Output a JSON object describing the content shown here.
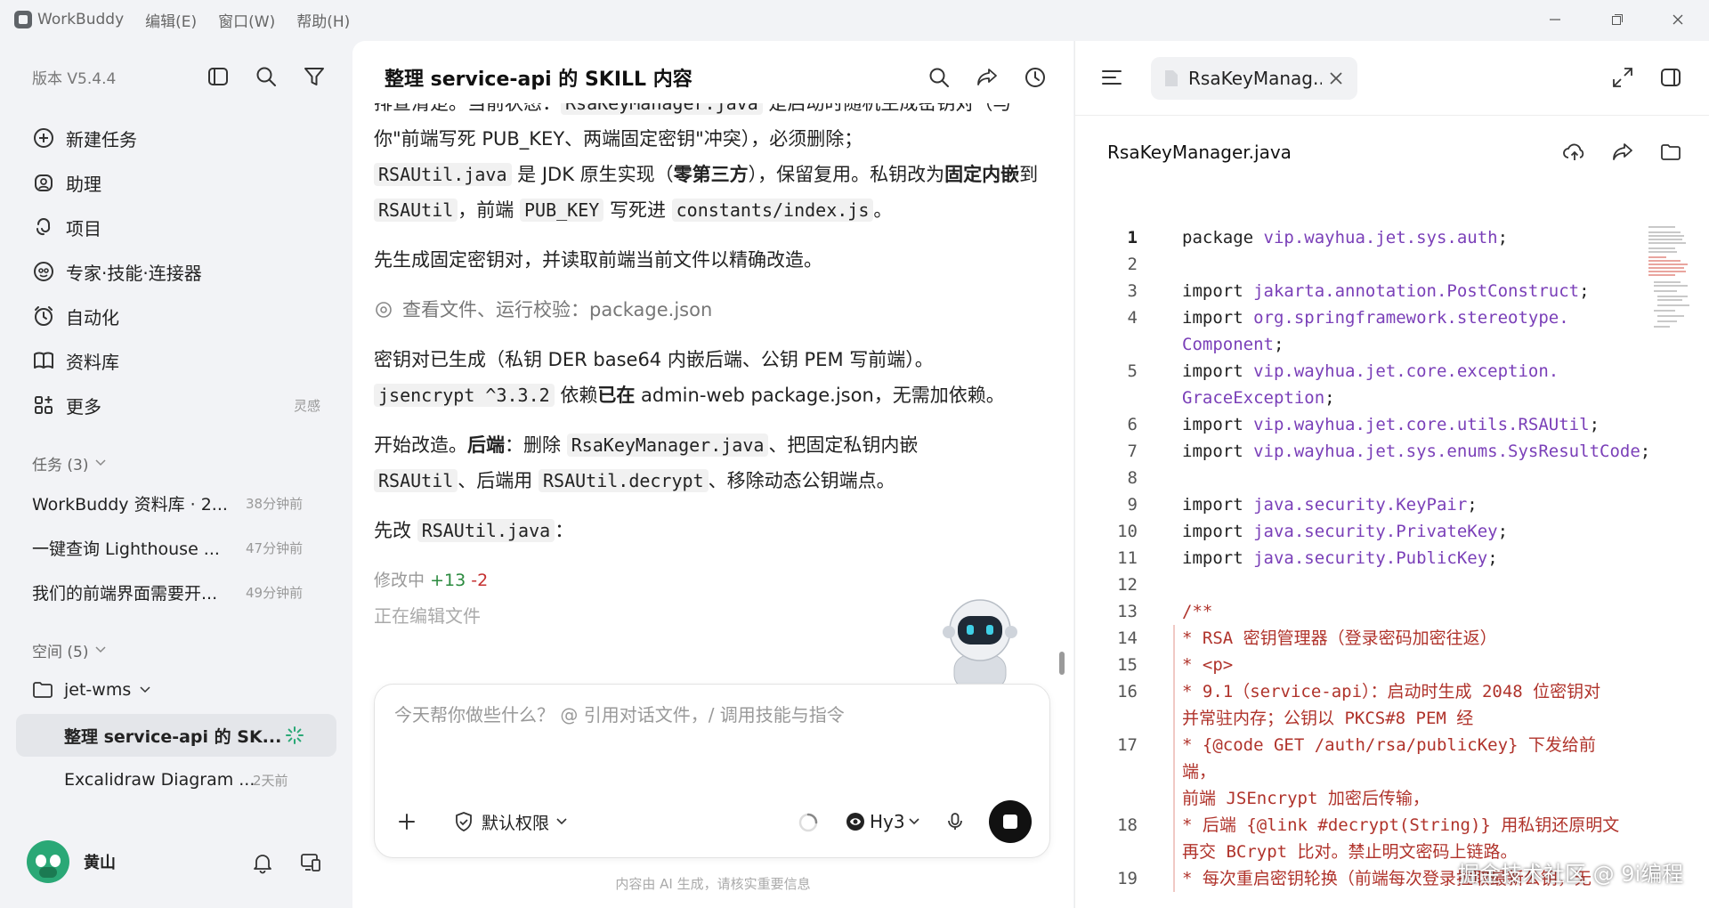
{
  "titlebar": {
    "app_name": "WorkBuddy",
    "menu": [
      "编辑(E)",
      "窗口(W)",
      "帮助(H)"
    ]
  },
  "sidebar": {
    "version": "版本 V5.4.4",
    "nav": [
      {
        "label": "新建任务",
        "icon": "plus-circle-icon"
      },
      {
        "label": "助理",
        "icon": "assistant-icon"
      },
      {
        "label": "项目",
        "icon": "project-icon"
      },
      {
        "label": "专家·技能·连接器",
        "icon": "expert-icon"
      },
      {
        "label": "自动化",
        "icon": "alarm-clock-icon"
      },
      {
        "label": "资料库",
        "icon": "book-icon"
      },
      {
        "label": "更多",
        "icon": "grid-icon",
        "badge": "灵感"
      }
    ],
    "tasks_header": "任务 (3)",
    "tasks": [
      {
        "title": "WorkBuddy 资料库 · 2...",
        "ago": "38分钟前"
      },
      {
        "title": "一键查询 Lighthouse ...",
        "ago": "47分钟前"
      },
      {
        "title": "我们的前端界面需要开...",
        "ago": "49分钟前"
      }
    ],
    "spaces_header": "空间 (5)",
    "project": "jet-wms",
    "project_items": [
      {
        "title": "整理 service-api 的 SK...",
        "active": true
      },
      {
        "title": "Excalidraw Diagram ...",
        "ago": "2天前"
      }
    ],
    "user_name": "黄山"
  },
  "chat": {
    "title": "整理 service-api 的 SKILL 内容",
    "line0_a": "排查清楚。当前状态：",
    "line0_code": "RsaKeyManager.java",
    "line0_b": " 是启动时随机生成密钥对（与你\"前端写死 PUB_KEY、两端固定密钥\"冲突），必须删除；",
    "p1_code1": "RSAUtil.java",
    "p1_a": " 是 JDK 原生实现（",
    "p1_b1": "零第三方",
    "p1_b": "），保留复用。私钥改为",
    "p1_b2": "固定内嵌",
    "p1_c": "到 ",
    "p1_code2": "RSAUtil",
    "p1_d": "，前端 ",
    "p1_code3": "PUB_KEY",
    "p1_e": " 写死进 ",
    "p1_code4": "constants/index.js",
    "p1_f": "。",
    "p2": "先生成固定密钥对，并读取前端当前文件以精确改造。",
    "tool_line": "查看文件、运行校验：package.json",
    "p3_a": "密钥对已生成（私钥 DER base64 内嵌后端、公钥 PEM 写前端）。",
    "p3_code": "jsencrypt ^3.3.2",
    "p3_b": " 依赖",
    "p3_bold": "已在",
    "p3_c": " admin-web package.json，无需加依赖。",
    "p4_a": "开始改造。",
    "p4_bold": "后端",
    "p4_b": "：删除 ",
    "p4_code1": "RsaKeyManager.java",
    "p4_c": "、把固定私钥内嵌 ",
    "p4_code2": "RSAUtil",
    "p4_d": "、后端用 ",
    "p4_code3": "RSAUtil.decrypt",
    "p4_e": "、移除动态公钥端点。",
    "p5_a": "先改 ",
    "p5_code": "RSAUtil.java",
    "p5_b": "：",
    "edit_label": "修改中",
    "edit_plus": "+13",
    "edit_minus": "-2",
    "editing": "正在编辑文件",
    "composer_placeholder": "今天帮你做些什么？ @ 引用对话文件，/ 调用技能与指令",
    "permission": "默认权限",
    "model": "Hy3",
    "footnote": "内容由 AI 生成，请核实重要信息"
  },
  "file": {
    "tab_name": "RsaKeyManag...",
    "file_name": "RsaKeyManager.java",
    "lines": [
      {
        "n": "1",
        "t": "package ",
        "p": "vip.wayhua.jet.sys.auth",
        "s": ";"
      },
      {
        "n": "2",
        "t": ""
      },
      {
        "n": "3",
        "t": "import ",
        "p": "jakarta.annotation.PostConstruct",
        "s": ";"
      },
      {
        "n": "4",
        "t": "import ",
        "p": "org.springframework.stereotype.\nComponent",
        "s": ";"
      },
      {
        "n": "5",
        "t": "import ",
        "p": "vip.wayhua.jet.core.exception.\nGraceException",
        "s": ";"
      },
      {
        "n": "6",
        "t": "import ",
        "p": "vip.wayhua.jet.core.utils.RSAUtil",
        "s": ";"
      },
      {
        "n": "7",
        "t": "import ",
        "p": "vip.wayhua.jet.sys.enums.SysResultCode",
        "s": ";"
      },
      {
        "n": "8",
        "t": ""
      },
      {
        "n": "9",
        "t": "import ",
        "p": "java.security.KeyPair",
        "s": ";"
      },
      {
        "n": "10",
        "t": "import ",
        "p": "java.security.PrivateKey",
        "s": ";"
      },
      {
        "n": "11",
        "t": "import ",
        "p": "java.security.PublicKey",
        "s": ";"
      },
      {
        "n": "12",
        "t": ""
      },
      {
        "n": "13",
        "c": "/**"
      },
      {
        "n": "14",
        "c": "* RSA 密钥管理器（登录密码加密往返）"
      },
      {
        "n": "15",
        "c": "* <p>"
      },
      {
        "n": "16",
        "c": "* 9.1（service-api）：启动时生成 2048 位密钥对\n并常驻内存；公钥以 PKCS#8 PEM 经"
      },
      {
        "n": "17",
        "c": "* {@code GET /auth/rsa/publicKey} 下发给前端，\n前端 JSEncrypt 加密后传输，"
      },
      {
        "n": "18",
        "c": "* 后端 {@link #decrypt(String)} 用私钥还原明文\n再交 BCrypt 比对。禁止明文密码上链路。"
      },
      {
        "n": "19",
        "c": "* 每次重启密钥轮换（前端每次登录拉取最新公钥，无"
      }
    ]
  },
  "watermark": "掘金技术社区 @ 9i编程",
  "colors": {
    "accent": "#2aa876",
    "code_package": "#7a3fb8",
    "code_comment": "#b0332b"
  }
}
